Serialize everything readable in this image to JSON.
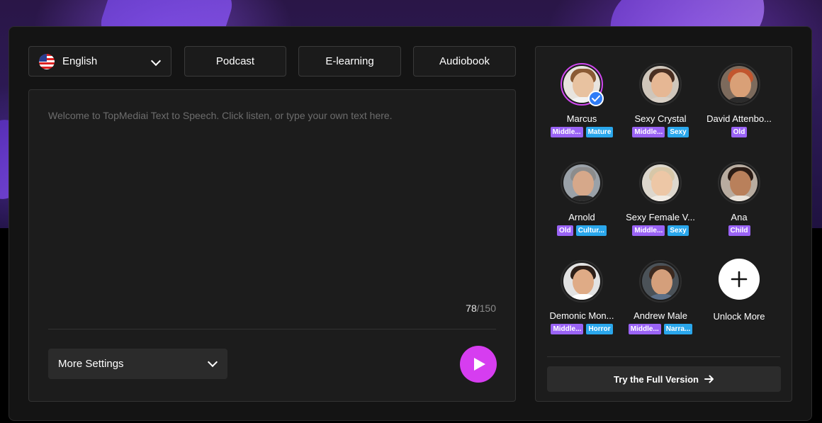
{
  "language": {
    "label": "English",
    "flag_icon": "us-flag-icon"
  },
  "presets": [
    "Podcast",
    "E-learning",
    "Audiobook"
  ],
  "editor": {
    "placeholder": "Welcome to TopMediai Text to Speech. Click listen, or type your own text here.",
    "char_count": "78",
    "char_max": "/150"
  },
  "settings": {
    "more_label": "More Settings"
  },
  "play": {
    "icon": "play-icon",
    "color": "#d63df0"
  },
  "voices": [
    {
      "name": "Marcus",
      "tags": [
        "Middle...",
        "Mature"
      ],
      "selected": true
    },
    {
      "name": "Sexy Crystal",
      "tags": [
        "Middle...",
        "Sexy"
      ],
      "selected": false
    },
    {
      "name": "David Attenbo...",
      "tags": [
        "Old"
      ],
      "selected": false
    },
    {
      "name": "Arnold",
      "tags": [
        "Old",
        "Cultur..."
      ],
      "selected": false
    },
    {
      "name": "Sexy Female V...",
      "tags": [
        "Middle...",
        "Sexy"
      ],
      "selected": false
    },
    {
      "name": "Ana",
      "tags": [
        "Child"
      ],
      "selected": false
    },
    {
      "name": "Demonic Mon...",
      "tags": [
        "Middle...",
        "Horror"
      ],
      "selected": false
    },
    {
      "name": "Andrew Male",
      "tags": [
        "Middle...",
        "Narra..."
      ],
      "selected": false
    }
  ],
  "unlock": {
    "label": "Unlock More",
    "icon": "plus-icon"
  },
  "try_full": {
    "label": "Try the Full Version",
    "icon": "arrow-right-icon"
  },
  "colors": {
    "accent": "#d63df0",
    "tag_purple": "#9a63f5",
    "tag_blue": "#2aa7ec",
    "selected_border": "#d048ef",
    "check_blue": "#2e7cf6"
  }
}
